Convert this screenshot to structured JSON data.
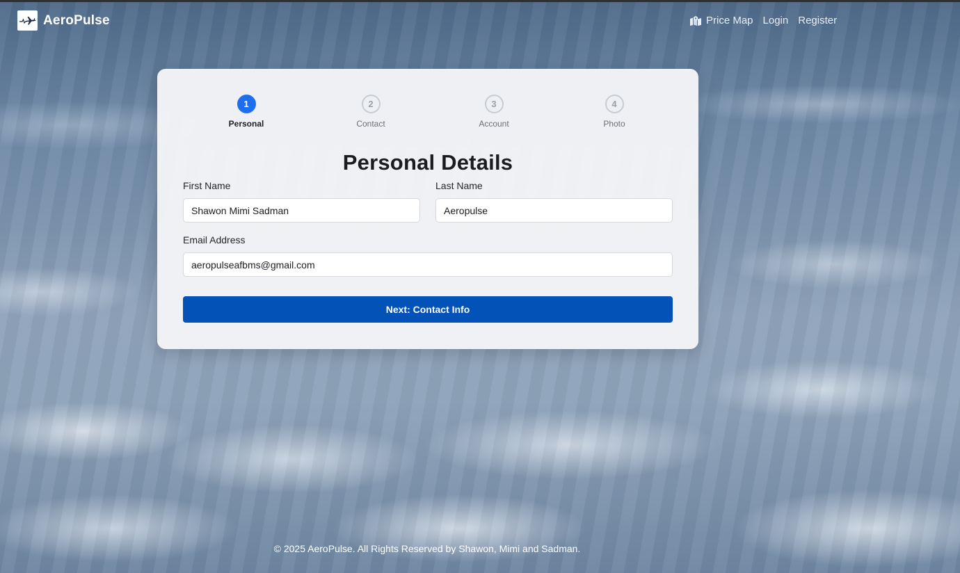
{
  "brand": {
    "name": "AeroPulse",
    "logo_icon": "airplane-pulse-icon"
  },
  "nav": {
    "price_map": {
      "label": "Price Map",
      "icon": "map-icon"
    },
    "login": "Login",
    "register": "Register"
  },
  "stepper": {
    "steps": [
      {
        "number": "1",
        "label": "Personal",
        "active": true
      },
      {
        "number": "2",
        "label": "Contact",
        "active": false
      },
      {
        "number": "3",
        "label": "Account",
        "active": false
      },
      {
        "number": "4",
        "label": "Photo",
        "active": false
      }
    ]
  },
  "form": {
    "title": "Personal Details",
    "first_name": {
      "label": "First Name",
      "value": "Shawon Mimi Sadman"
    },
    "last_name": {
      "label": "Last Name",
      "value": "Aeropulse"
    },
    "email": {
      "label": "Email Address",
      "value": "aeropulseafbms@gmail.com"
    },
    "next_button": "Next: Contact Info"
  },
  "footer": {
    "text": "© 2025 AeroPulse. All Rights Reserved by Shawon, Mimi and Sadman."
  },
  "colors": {
    "primary": "#0352b8",
    "step_active": "#1e6ef0",
    "card_bg": "#f3f4f6"
  }
}
